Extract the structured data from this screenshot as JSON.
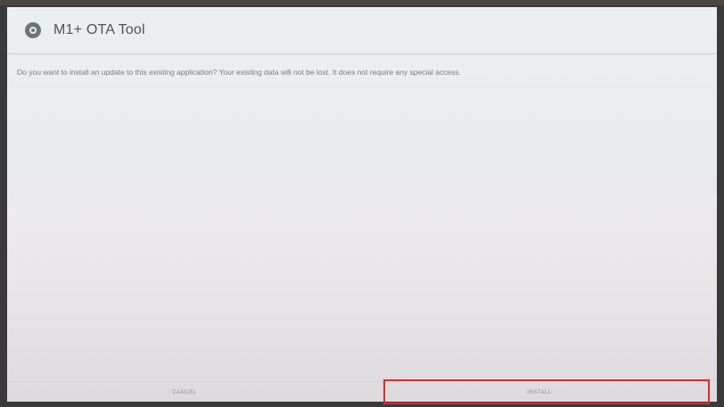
{
  "window": {
    "title": "M1+ OTA Tool",
    "icon": "app-circle-icon"
  },
  "dialog": {
    "message": "Do you want to install an update to this existing application? Your existing data will not be lost. It does not require any special access."
  },
  "buttons": {
    "cancel_label": "CANCEL",
    "install_label": "INSTALL"
  },
  "colors": {
    "highlight": "#e3262d"
  }
}
